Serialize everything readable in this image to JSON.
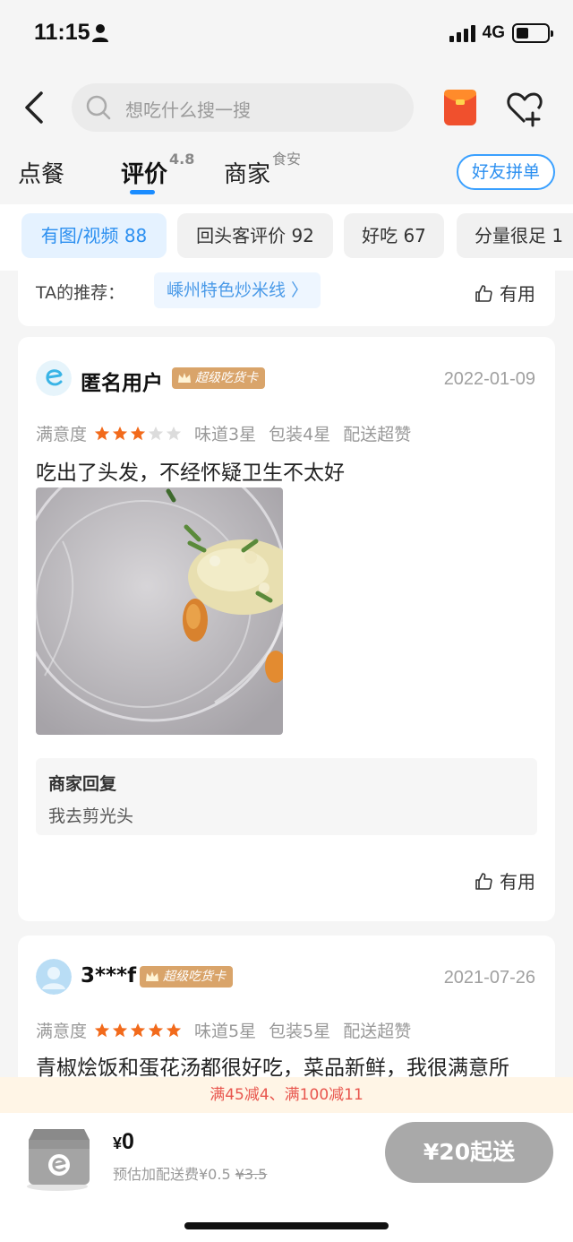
{
  "status_bar": {
    "time": "11:15",
    "network": "4G"
  },
  "header": {
    "search_placeholder": "想吃什么搜一搜"
  },
  "tabs": [
    {
      "label": "点餐",
      "sup": ""
    },
    {
      "label": "评价",
      "sup": "4.8"
    },
    {
      "label": "商家",
      "sup": "食安"
    }
  ],
  "group_order_label": "好友拼单",
  "chips": [
    "有图/视频 88",
    "回头客评价 92",
    "好吃 67",
    "分量很足 1"
  ],
  "prev_card": {
    "rec_label": "TA的推荐：",
    "rec_tag": "嵊州特色炒米线 〉",
    "useful": "有用"
  },
  "reviews": [
    {
      "user": "匿名用户",
      "badge": "超级吃货卡",
      "date": "2022-01-09",
      "satisfaction_label": "满意度",
      "stars": 3,
      "taste": "味道3星",
      "package": "包装4星",
      "delivery": "配送超赞",
      "text": "吃出了头发，不经怀疑卫生不太好",
      "reply_title": "商家回复",
      "reply_text": "我去剪光头",
      "useful": "有用"
    },
    {
      "user": "3***f",
      "badge": "超级吃货卡",
      "date": "2021-07-26",
      "satisfaction_label": "满意度",
      "stars": 5,
      "taste": "味道5星",
      "package": "包装5星",
      "delivery": "配送超赞",
      "text": "青椒烩饭和蛋花汤都很好吃，菜品新鲜，我很满意所"
    }
  ],
  "promo": "满45减4、满100减11",
  "cart": {
    "currency": "¥",
    "amount": "0",
    "fee_label": "预估加配送费¥0.5",
    "fee_original": "¥3.5",
    "checkout_label": "¥20起送"
  },
  "colors": {
    "accent": "#2b8ff0",
    "star": "#f26a1b",
    "promo": "#e8554d",
    "badge": "#d9a46a"
  }
}
